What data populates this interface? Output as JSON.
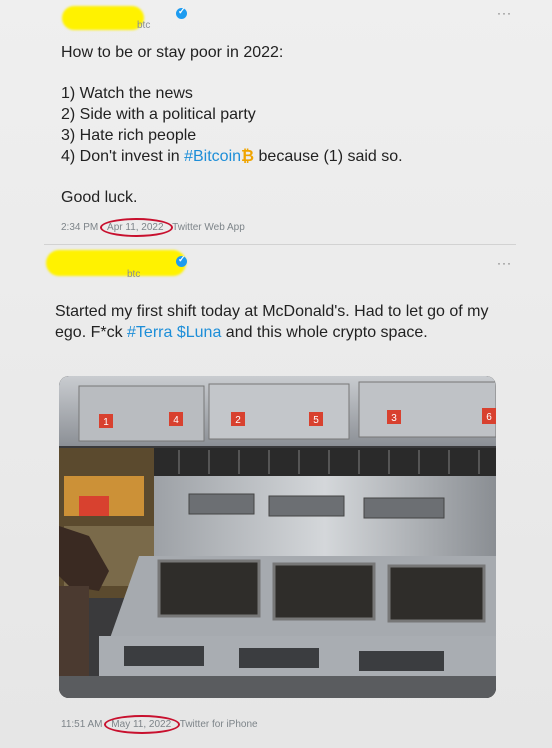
{
  "tweet1": {
    "handle_suffix": "btc",
    "more_icon": "ellipsis-icon",
    "text_lines": [
      "How to be or stay poor in 2022:",
      "1) Watch the news",
      "2) Side with a political party",
      "3) Hate rich people"
    ],
    "line4_prefix": "4) Don't invest in ",
    "line4_hashtag": "#Bitcoin",
    "line4_icon": "₿",
    "line4_suffix": " because (1) said so.",
    "closing": "Good luck.",
    "time": "2:34 PM",
    "date": "Apr 11, 2022",
    "source": "Twitter Web App"
  },
  "tweet2": {
    "handle_suffix": "btc",
    "more_icon": "ellipsis-icon",
    "text_part1": "Started my first shift today at McDonald's. Had to let go of my ego. F*ck ",
    "hashtag": "#Terra",
    "cashtag": "$Luna",
    "text_part2": " and this whole crypto space.",
    "photo_labels": [
      "1",
      "4",
      "2",
      "5",
      "3",
      "6"
    ],
    "time": "11:51 AM",
    "date": "May 11, 2022",
    "source": "Twitter for iPhone"
  },
  "colors": {
    "redaction": "#fff200",
    "link": "#1d8ed8",
    "verified": "#1d9bf0",
    "circle_annotation": "#c8102e"
  }
}
